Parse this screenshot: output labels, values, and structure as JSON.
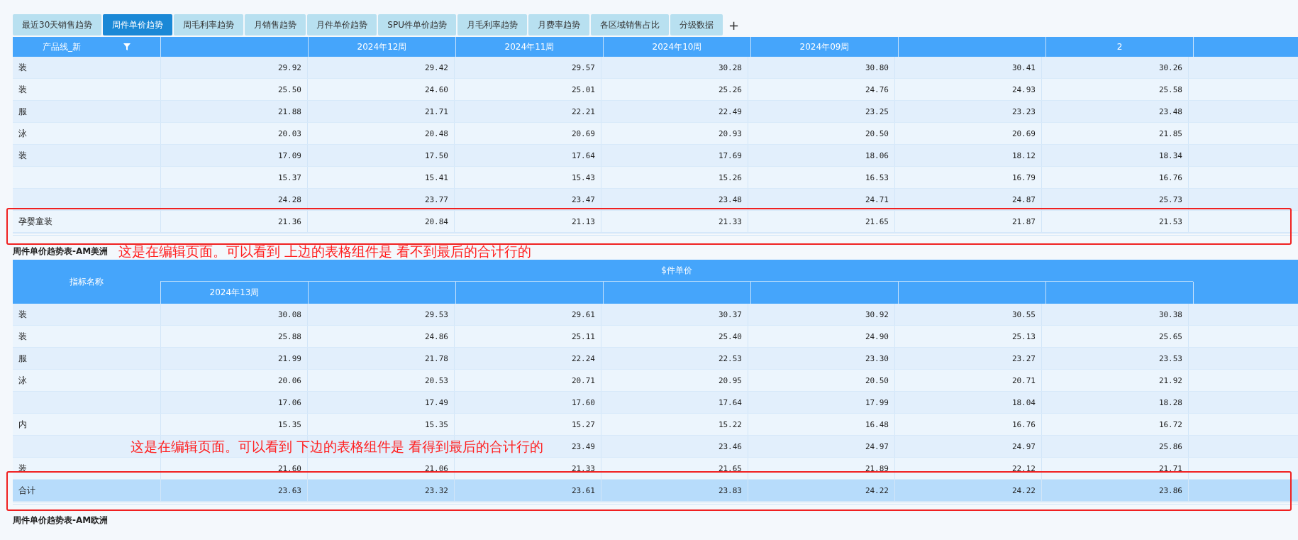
{
  "tabs": [
    {
      "label": "最近30天销售趋势",
      "selected": false
    },
    {
      "label": "周件单价趋势",
      "selected": true
    },
    {
      "label": "周毛利率趋势",
      "selected": false
    },
    {
      "label": "月销售趋势",
      "selected": false
    },
    {
      "label": "月件单价趋势",
      "selected": false
    },
    {
      "label": "SPU件单价趋势",
      "selected": false
    },
    {
      "label": "月毛利率趋势",
      "selected": false
    },
    {
      "label": "月费率趋势",
      "selected": false
    },
    {
      "label": "各区域销售占比",
      "selected": false
    },
    {
      "label": "分级数据",
      "selected": false
    }
  ],
  "add_tab": "+",
  "tables": [
    {
      "first_header": {
        "text": "产品线_新",
        "filter": true
      },
      "columns": [
        {},
        {
          "header": "2024年12周"
        },
        {
          "header": "2024年11周"
        },
        {
          "header": "2024年10周"
        },
        {
          "header": "2024年09周"
        },
        {},
        {
          "header": "2"
        },
        {}
      ],
      "rows": [
        {
          "kind": "data",
          "label": "装",
          "values": [
            "29.92",
            "29.42",
            "29.57",
            "30.28",
            "30.80",
            "30.41",
            "30.26"
          ]
        },
        {
          "kind": "data",
          "label": "装",
          "values": [
            "25.50",
            "24.60",
            "25.01",
            "25.26",
            "24.76",
            "24.93",
            "25.58"
          ]
        },
        {
          "kind": "data",
          "label": "服",
          "values": [
            "21.88",
            "21.71",
            "22.21",
            "22.49",
            "23.25",
            "23.23",
            "23.48"
          ]
        },
        {
          "kind": "data",
          "label": "泳",
          "values": [
            "20.03",
            "20.48",
            "20.69",
            "20.93",
            "20.50",
            "20.69",
            "21.85"
          ]
        },
        {
          "kind": "data",
          "label": "装",
          "values": [
            "17.09",
            "17.50",
            "17.64",
            "17.69",
            "18.06",
            "18.12",
            "18.34"
          ]
        },
        {
          "kind": "data",
          "values": [
            "15.37",
            "15.41",
            "15.43",
            "15.26",
            "16.53",
            "16.79",
            "16.76"
          ]
        },
        {
          "kind": "data",
          "values": [
            "24.28",
            "23.77",
            "23.47",
            "23.48",
            "24.71",
            "24.87",
            "25.73"
          ]
        },
        {
          "kind": "data",
          "label": "孕婴童装",
          "values": [
            "21.36",
            "20.84",
            "21.13",
            "21.33",
            "21.65",
            "21.87",
            "21.53"
          ]
        }
      ]
    },
    {
      "title": "周件单价趋势表-AM美洲",
      "first_header": {
        "text": "指标名称",
        "filter": false
      },
      "group_header": "$件单价",
      "columns": [
        {
          "header": "2024年13周"
        },
        {},
        {},
        {},
        {},
        {},
        {},
        {}
      ],
      "rows": [
        {
          "kind": "data",
          "label": "装",
          "values": [
            "30.08",
            "29.53",
            "29.61",
            "30.37",
            "30.92",
            "30.55",
            "30.38"
          ]
        },
        {
          "kind": "data",
          "label": "装",
          "values": [
            "25.88",
            "24.86",
            "25.11",
            "25.40",
            "24.90",
            "25.13",
            "25.65"
          ]
        },
        {
          "kind": "data",
          "label": "服",
          "values": [
            "21.99",
            "21.78",
            "22.24",
            "22.53",
            "23.30",
            "23.27",
            "23.53"
          ]
        },
        {
          "kind": "data",
          "label": "泳",
          "values": [
            "20.06",
            "20.53",
            "20.71",
            "20.95",
            "20.50",
            "20.71",
            "21.92"
          ]
        },
        {
          "kind": "data",
          "values": [
            "17.06",
            "17.49",
            "17.60",
            "17.64",
            "17.99",
            "18.04",
            "18.28"
          ]
        },
        {
          "kind": "data",
          "label": "内",
          "values": [
            "15.35",
            "15.35",
            "15.27",
            "15.22",
            "16.48",
            "16.76",
            "16.72"
          ]
        },
        {
          "kind": "data",
          "leading_covered": true,
          "values": [
            "23.49",
            "23.46",
            "24.97",
            "24.97",
            "25.86"
          ]
        },
        {
          "kind": "data",
          "label": "装",
          "values": [
            "21.60",
            "21.06",
            "21.33",
            "21.65",
            "21.89",
            "22.12",
            "21.71"
          ]
        },
        {
          "kind": "total",
          "label": "合计",
          "values": [
            "23.63",
            "23.32",
            "23.61",
            "23.83",
            "24.22",
            "24.22",
            "23.86"
          ]
        }
      ]
    },
    {
      "title": "周件单价趋势表-AM欧洲"
    }
  ],
  "annotations": [
    {
      "text": "这是在编辑页面。可以看到 上边的表格组件是 看不到最后的合计行的"
    },
    {
      "text": "这是在编辑页面。可以看到 下边的表格组件是 看得到最后的合计行的"
    }
  ]
}
